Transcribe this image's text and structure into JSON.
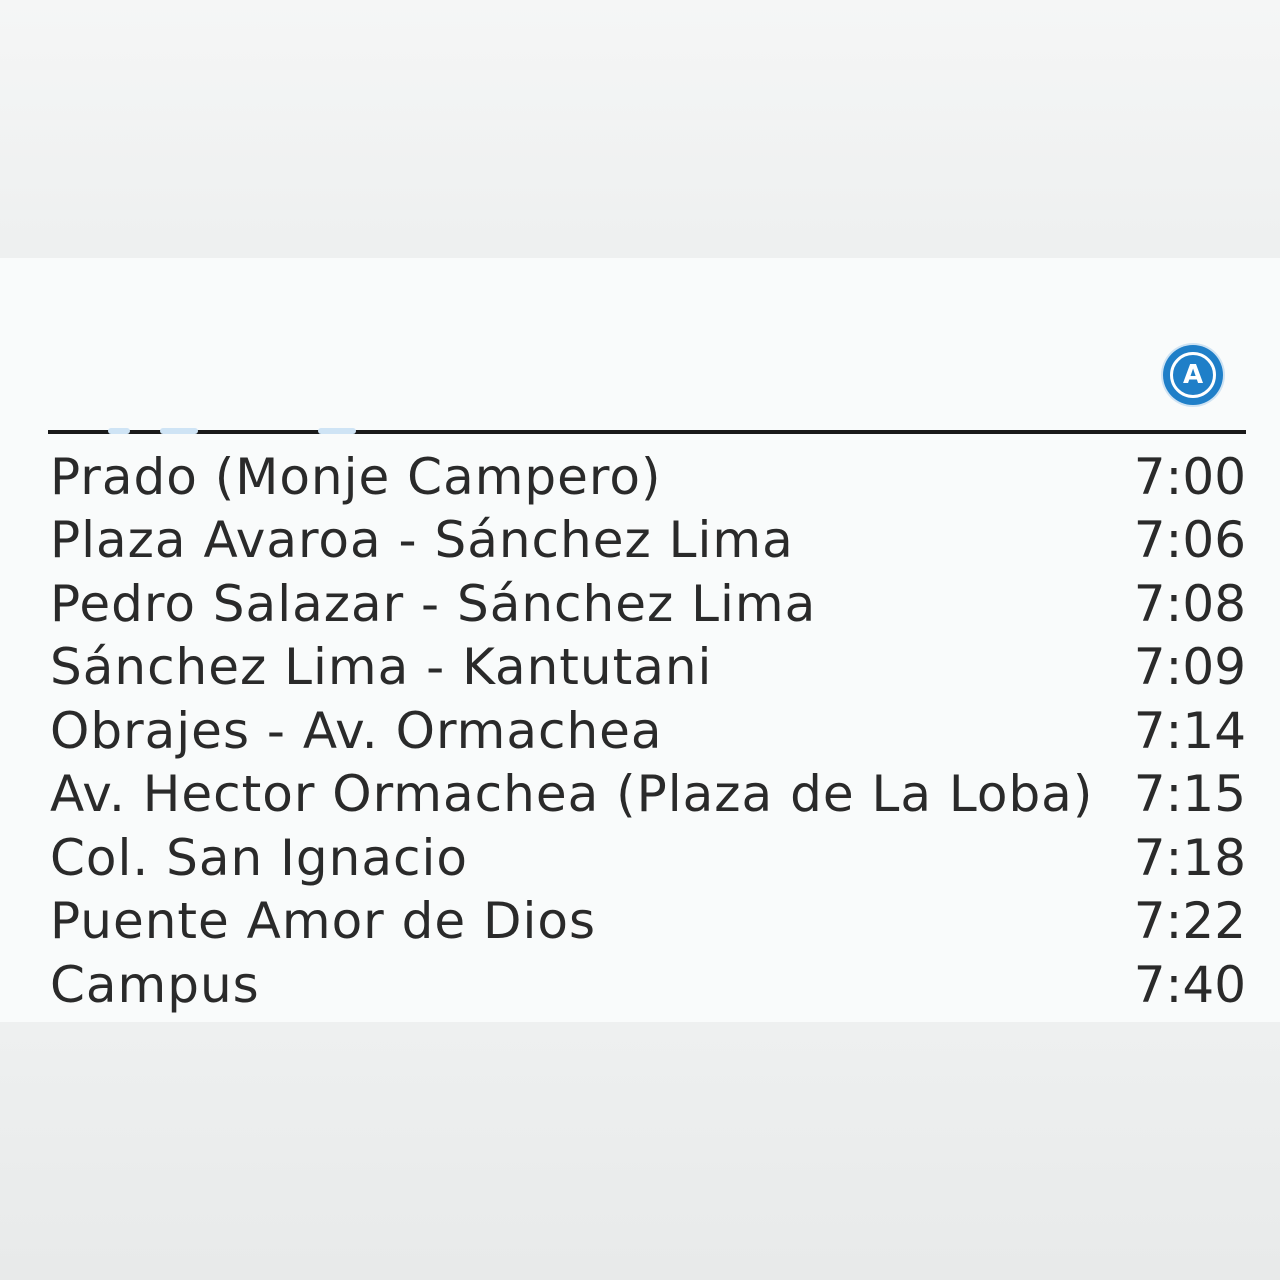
{
  "route": {
    "badge_letter": "A",
    "badge_color": "#1f7fc8"
  },
  "stops": [
    {
      "name": "Prado (Monje Campero)",
      "time": "7:00"
    },
    {
      "name": "Plaza Avaroa - Sánchez Lima",
      "time": "7:06"
    },
    {
      "name": "Pedro Salazar - Sánchez Lima",
      "time": "7:08"
    },
    {
      "name": "Sánchez Lima - Kantutani",
      "time": "7:09"
    },
    {
      "name": "Obrajes - Av. Ormachea",
      "time": "7:14"
    },
    {
      "name": "Av. Hector Ormachea (Plaza de La Loba)",
      "time": "7:15"
    },
    {
      "name": "Col. San Ignacio",
      "time": "7:18"
    },
    {
      "name": "Puente Amor de Dios",
      "time": "7:22"
    },
    {
      "name": "Campus",
      "time": "7:40"
    }
  ],
  "colors": {
    "text": "#2a2a2a",
    "rule": "#1a1a1a",
    "background": "#f9fbfb"
  }
}
